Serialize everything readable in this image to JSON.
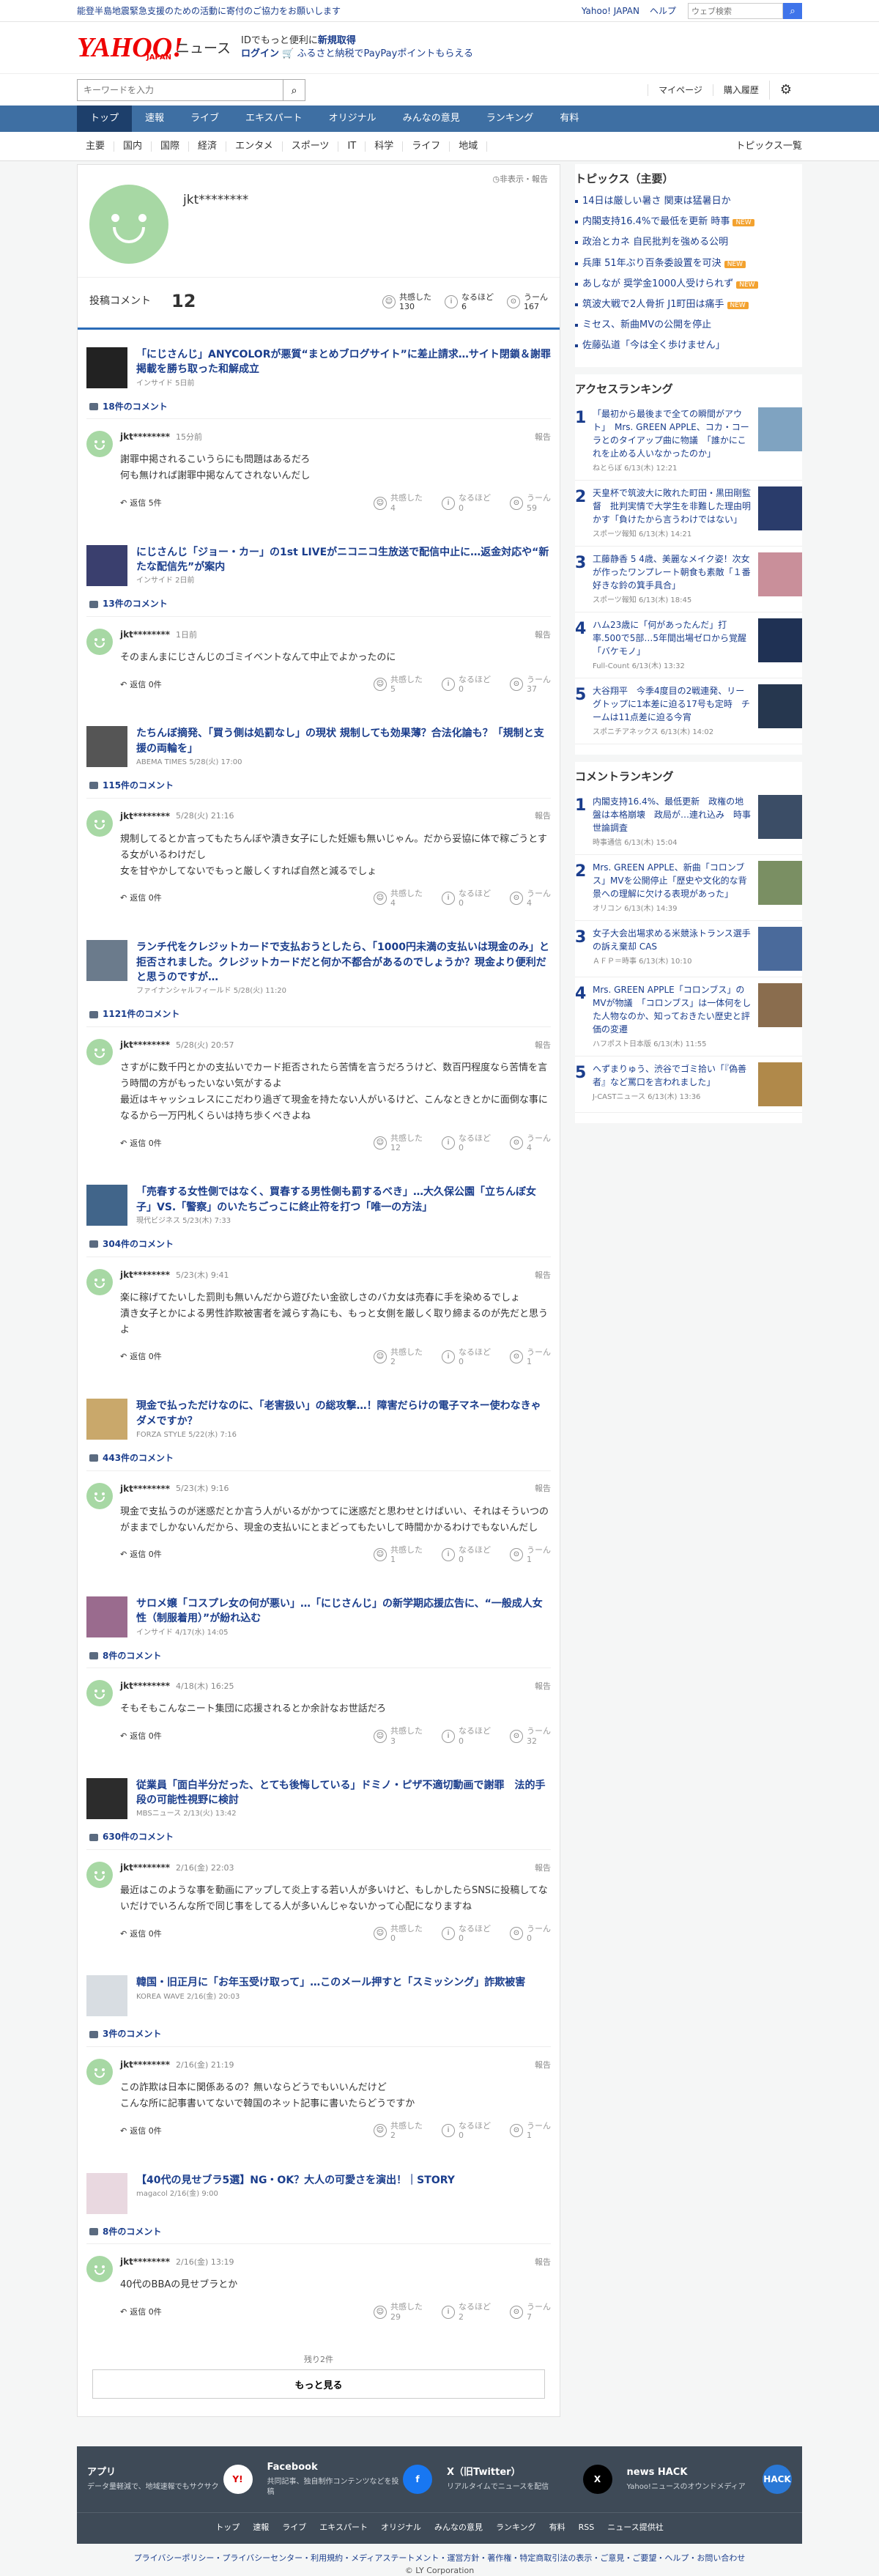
{
  "topbar": {
    "notice": "能登半島地震緊急支援のための活動に寄付のご協力をお願いします",
    "links": [
      "Yahoo! JAPAN",
      "ヘルプ"
    ],
    "search_placeholder": "ウェブ検索"
  },
  "masthead": {
    "logo": "YAHOO!",
    "logo_sub": "JAPAN",
    "service": "ニュース",
    "promo1a": "IDでもっと便利に",
    "promo1b": "新規取得",
    "promo2a": "ログイン",
    "promo2b": "ふるさと納税でPayPayポイントもらえる"
  },
  "toolbar": {
    "search_placeholder": "キーワードを入力",
    "mypage": "マイページ",
    "history": "購入履歴"
  },
  "gnav": [
    "トップ",
    "速報",
    "ライブ",
    "エキスパート",
    "オリジナル",
    "みんなの意見",
    "ランキング",
    "有料"
  ],
  "subnav": {
    "items": [
      "主要",
      "国内",
      "国際",
      "経済",
      "エンタメ",
      "スポーツ",
      "IT",
      "科学",
      "ライフ",
      "地域"
    ],
    "topics_link": "トピックス一覧"
  },
  "profile": {
    "report": "非表示・報告",
    "name": "jkt********",
    "comments_label": "投稿コメント",
    "comments_count": "12",
    "reactions": [
      {
        "label": "共感した",
        "value": "130"
      },
      {
        "label": "なるほど",
        "value": "6"
      },
      {
        "label": "うーん",
        "value": "167"
      }
    ]
  },
  "comments": [
    {
      "title": "「にじさんじ」ANYCOLORが悪質“まとめブログサイト”に差止請求…サイト閉鎖＆謝罪掲載を勝ち取った和解成立",
      "meta": "インサイド 5日前",
      "count": "18件のコメント",
      "user": "jkt********",
      "time": "15分前",
      "text": "謝罪中掲されるこいうらにも問題はあるだろ\n何も無ければ謝罪中掲なんてされないんだし",
      "replies": "返信 5件",
      "r1": "4",
      "r2": "0",
      "r3": "59",
      "thumb": "#222"
    },
    {
      "title": "にじさんじ「ジョー・カー」の1st LIVEがニコニコ生放送で配信中止に…返金対応や“新たな配信先”が案内",
      "meta": "インサイド 2日前",
      "count": "13件のコメント",
      "user": "jkt********",
      "time": "1日前",
      "text": "そのまんまにじさんじのゴミイベントなんて中止でよかったのに",
      "replies": "返信 0件",
      "r1": "5",
      "r2": "0",
      "r3": "37",
      "thumb": "#3a3f6e"
    },
    {
      "title": "たちんぼ摘発、「買う側は処罰なし」の現状 規制しても効果薄？合法化論も？「規制と支援の両輪を」",
      "meta": "ABEMA TIMES 5/28(火) 17:00",
      "count": "115件のコメント",
      "user": "jkt********",
      "time": "5/28(火) 21:16",
      "text": "規制してるとか言ってもたちんぼや漬き女子にした妊娠も無いじゃん。だから妥協に体で稼ごうとする女がいるわけだし\n女を甘やかしてないでもっと厳しくすれば自然と減るでしょ",
      "replies": "返信 0件",
      "r1": "4",
      "r2": "0",
      "r3": "4",
      "thumb": "#555"
    },
    {
      "title": "ランチ代をクレジットカードで支払おうとしたら、「1000円未満の支払いは現金のみ」と拒否されました。クレジットカードだと何か不都合があるのでしょうか？現金より便利だと思うのですが…",
      "meta": "ファイナンシャルフィールド 5/28(火) 11:20",
      "count": "1121件のコメント",
      "user": "jkt********",
      "time": "5/28(火) 20:57",
      "text": "さすがに数千円とかの支払いでカード拒否されたら苦情を言うだろうけど、数百円程度なら苦情を言う時間の方がもったいない気がするよ\n最近はキャッシュレスにこだわり過ぎて現金を持たない人がいるけど、こんなときとかに面倒な事になるから一万円札くらいは持ち歩くべきよね",
      "replies": "返信 0件",
      "r1": "12",
      "r2": "0",
      "r3": "4",
      "thumb": "#6b7b8c"
    },
    {
      "title": "「売春する女性側ではなく、買春する男性側も罰するべき」…大久保公園「立ちんぼ女子」VS.「警察」のいたちごっこに終止符を打つ「唯一の方法」",
      "meta": "現代ビジネス 5/23(木) 7:33",
      "count": "304件のコメント",
      "user": "jkt********",
      "time": "5/23(木) 9:41",
      "text": "楽に稼げてたいした罰則も無いんだから遊びたい金欲しさのバカ女は売春に手を染めるでしょ\n漬き女子とかによる男性詐欺被害者を減らす為にも、もっと女側を厳しく取り締まるのが先だと思うよ",
      "replies": "返信 0件",
      "r1": "2",
      "r2": "0",
      "r3": "1",
      "thumb": "#41658a"
    },
    {
      "title": "現金で払っただけなのに、「老害扱い」の総攻撃…！障害だらけの電子マネー使わなきゃダメですか？",
      "meta": "FORZA STYLE 5/22(水) 7:16",
      "count": "443件のコメント",
      "user": "jkt********",
      "time": "5/23(木) 9:16",
      "text": "現金で支払うのが迷惑だとか言う人がいるがかつてに迷惑だと思わせとけばいい、それはそういつのがままでしかないんだから、現金の支払いにとまどってもたいして時間かかるわけでもないんだし",
      "replies": "返信 0件",
      "r1": "1",
      "r2": "0",
      "r3": "1",
      "thumb": "#c9a86b"
    },
    {
      "title": "サロメ嬢「コスプレ女の何が悪い」…「にじさんじ」の新学期応援広告に、“一般成人女性（制服着用）”が紛れ込む",
      "meta": "インサイド 4/17(水) 14:05",
      "count": "8件のコメント",
      "user": "jkt********",
      "time": "4/18(木) 16:25",
      "text": "そもそもこんなニート集団に応援されるとか余計なお世話だろ",
      "replies": "返信 0件",
      "r1": "3",
      "r2": "0",
      "r3": "32",
      "thumb": "#9a6b8e"
    },
    {
      "title": "従業員「面白半分だった、とても後悔している」ドミノ・ピザ不適切動画で謝罪　法的手段の可能性視野に検討",
      "meta": "MBSニュース 2/13(火) 13:42",
      "count": "630件のコメント",
      "user": "jkt********",
      "time": "2/16(金) 22:03",
      "text": "最近はこのような事を動画にアップして炎上する若い人が多いけど、もしかしたらSNSに投稿してないだけでいろんな所で同じ事をしてる人が多いんじゃないかって心配になりますね",
      "replies": "返信 0件",
      "r1": "0",
      "r2": "0",
      "r3": "0",
      "thumb": "#2c2c2c"
    },
    {
      "title": "韓国・旧正月に「お年玉受け取って」…このメール押すと「スミッシング」詐欺被害",
      "meta": "KOREA WAVE 2/16(金) 20:03",
      "count": "3件のコメント",
      "user": "jkt********",
      "time": "2/16(金) 21:19",
      "text": "この詐欺は日本に関係あるの？無いならどうでもいいんだけど\nこんな所に記事書いてないで韓国のネット記事に書いたらどうですか",
      "replies": "返信 0件",
      "r1": "2",
      "r2": "0",
      "r3": "1",
      "thumb": "#d8dde2"
    },
    {
      "title": "【40代の見せブラ5選】NG・OK？大人の可愛さを演出！｜STORY",
      "meta": "magacol 2/16(金) 9:00",
      "count": "8件のコメント",
      "user": "jkt********",
      "time": "2/16(金) 13:19",
      "text": "40代のBBAの見せブラとか",
      "replies": "返信 0件",
      "r1": "29",
      "r2": "2",
      "r3": "7",
      "thumb": "#e9d8e0"
    }
  ],
  "more": {
    "remaining": "残り2件",
    "button": "もっと見る"
  },
  "sidebar": {
    "topics_title": "トピックス（主要）",
    "topics": [
      {
        "t": "14日は厳しい暑さ 関東は猛暑日か",
        "tag": ""
      },
      {
        "t": "内閣支持16.4%で最低を更新 時事",
        "tag": "NEW"
      },
      {
        "t": "政治とカネ 自民批判を強める公明",
        "tag": ""
      },
      {
        "t": "兵庫 51年ぶり百条委設置を可決",
        "tag": "NEW"
      },
      {
        "t": "あしなが 奨学金1000人受けられず",
        "tag": "NEW"
      },
      {
        "t": "筑波大戦で2人骨折 J1町田は痛手",
        "tag": "NEW"
      },
      {
        "t": "ミセス、新曲MVの公開を停止",
        "tag": ""
      },
      {
        "t": "佐藤弘道「今は全く歩けません」",
        "tag": ""
      }
    ],
    "access_title": "アクセスランキング",
    "access": [
      {
        "t": "「最初から最後まで全ての瞬間がアウト」　Mrs. GREEN APPLE、コカ・コーラとのタイアップ曲に物議　「誰かにこれを止める人いなかったのか」",
        "m": "ねとらぼ 6/13(木) 12:21",
        "c": "#7fa3c1"
      },
      {
        "t": "天皇杯で筑波大に敗れた町田・黒田剛監督　批判実情で大学生を非難した理由明かす「負けたから言うわけではない」",
        "m": "スポーツ報知 6/13(木) 14:21",
        "c": "#2a3c6b"
      },
      {
        "t": "工藤静香 5 4歳、美麗なメイク姿！次女が作ったワンプレート朝食も素敵「１番好きな鈴の箕手具合」",
        "m": "スポーツ報知 6/13(木) 18:45",
        "c": "#c98f9a"
      },
      {
        "t": "ハム23歳に「何があったんだ」打率.500で5部…5年間出場ゼロから覚醒「バケモノ」",
        "m": "Full-Count 6/13(木) 13:32",
        "c": "#1f3154"
      },
      {
        "t": "大谷翔平　今季4度目の2戦連発、リーグトップに1本差に迫る17号も定時　チームは11点差に迫る今宵",
        "m": "スポニチアネックス 6/13(木) 14:02",
        "c": "#26374f"
      }
    ],
    "comment_title": "コメントランキング",
    "comment": [
      {
        "t": "内閣支持16.4%、最低更新　政権の地盤は本格崩壊　政局が…連れ込み　時事世論調査",
        "m": "時事通信 6/13(木) 15:04",
        "c": "#3b4d66"
      },
      {
        "t": "Mrs. GREEN APPLE、新曲「コロンブス」MVを公開停止「歴史や文化的な背景への理解に欠ける表現があった」",
        "m": "オリコン 6/13(木) 14:39",
        "c": "#7a8f63"
      },
      {
        "t": "女子大会出場求める米競泳トランス選手の訴え棄却 CAS",
        "m": "ＡＦＰ＝時事 6/13(木) 10:10",
        "c": "#4a6a9b"
      },
      {
        "t": "Mrs. GREEN APPLE「コロンブス」のMVが物議　「コロンブス」は一体何をした人物なのか、知っておきたい歴史と評価の変遷",
        "m": "ハフポスト日本版 6/13(木) 11:55",
        "c": "#8a6d4e"
      },
      {
        "t": "へずまりゅう、渋谷でゴミ拾い「『偽善者』など罵口を言われました」",
        "m": "J-CASTニュース 6/13(木) 13:36",
        "c": "#b0894a"
      }
    ]
  },
  "footer": {
    "apps": [
      {
        "name": "アプリ",
        "desc": "データ量軽減で、地域速報でもサクサク",
        "icon": "Y!",
        "color": "#ffffff",
        "fg": "#d00"
      },
      {
        "name": "Facebook",
        "desc": "共同記事、独自制作コンテンツなどを投稿",
        "icon": "f",
        "color": "#1877f2",
        "fg": "#fff"
      },
      {
        "name": "X（旧Twitter）",
        "desc": "リアルタイムでニュースを配信",
        "icon": "X",
        "color": "#000000",
        "fg": "#fff"
      },
      {
        "name": "news HACK",
        "desc": "Yahoo!ニュースのオウンドメディア",
        "icon": "HACK",
        "color": "#2a78d6",
        "fg": "#fff"
      }
    ],
    "nav": [
      "トップ",
      "速報",
      "ライブ",
      "エキスパート",
      "オリジナル",
      "みんなの意見",
      "ランキング",
      "有料",
      "RSS",
      "ニュース提供社"
    ]
  },
  "legal": "プライバシーポリシー・プライバシーセンター・利用規約・メディアステートメント・運営方針・著作権・特定商取引法の表示・ご意見・ご要望・ヘルプ・お問い合わせ",
  "copyright": "© LY Corporation"
}
